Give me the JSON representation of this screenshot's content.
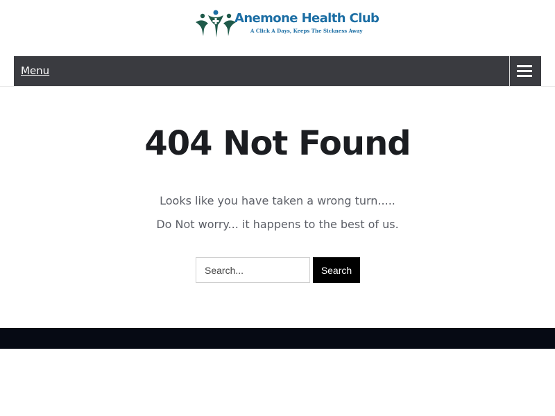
{
  "header": {
    "logo": {
      "title": "Anemone Health Club",
      "tagline": "A Click A Days, Keeps The Sickness Away",
      "icon": "health-figures-logo-icon",
      "colors": {
        "title": "#1c6ea4",
        "figure_dark": "#1f5a4a",
        "figure_blue": "#1c6ea4"
      }
    }
  },
  "nav": {
    "menu_label": "Menu",
    "toggle_icon": "hamburger-icon",
    "background": "#3a3b40"
  },
  "main": {
    "title": "404 Not Found",
    "message_line1": "Looks like you have taken a wrong turn.....",
    "message_line2": "Do Not worry... it happens to the best of us.",
    "search": {
      "placeholder": "Search...",
      "value": "",
      "button_label": "Search"
    }
  },
  "footer": {
    "background": "#060a14"
  }
}
